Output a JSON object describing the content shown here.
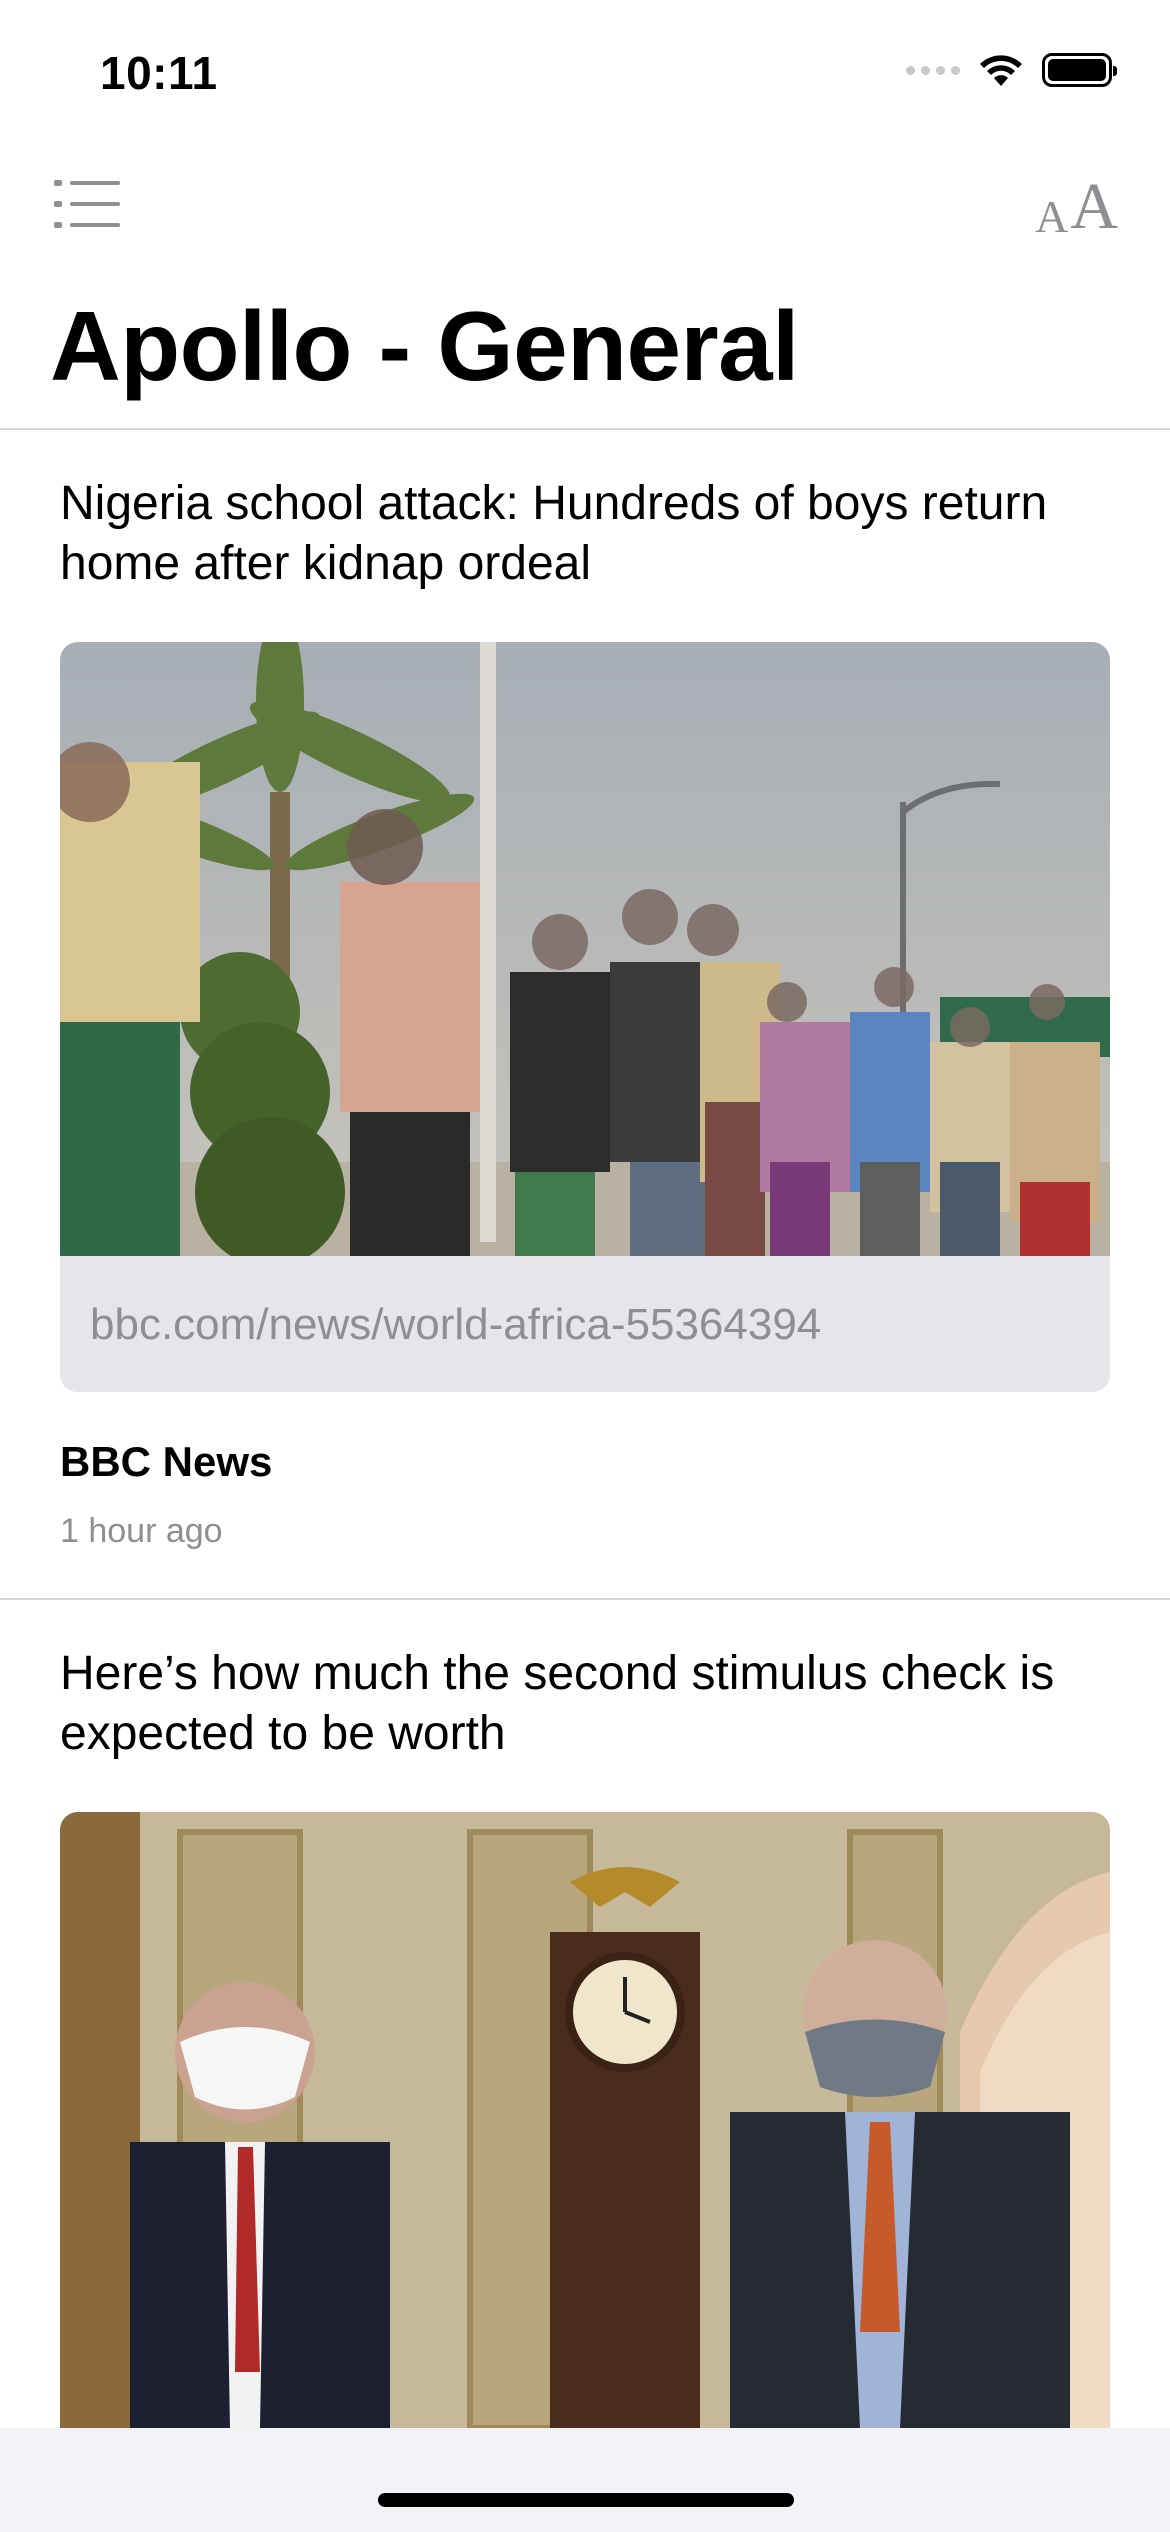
{
  "status_bar": {
    "time": "10:11",
    "icons": [
      "signal-icon",
      "wifi-icon",
      "battery-icon"
    ]
  },
  "nav": {
    "menu_icon": "list-icon",
    "font_size_icon_small": "A",
    "font_size_icon_large": "A"
  },
  "page_title": "Apollo - General",
  "articles": [
    {
      "headline": "Nigeria school attack: Hundreds of boys return home after kidnap ordeal",
      "link": "bbc.com/news/world-africa-55364394",
      "source": "BBC News",
      "time_ago": "1 hour ago",
      "image_description": "photo-boys-walking"
    },
    {
      "headline": "Here’s how much the second stimulus check is expected to be worth",
      "image_description": "photo-two-men-masks-capitol"
    }
  ],
  "colors": {
    "accent_gray": "#8e8e93",
    "link_bar_bg": "#e5e5ea",
    "divider": "#d8d8dc"
  }
}
